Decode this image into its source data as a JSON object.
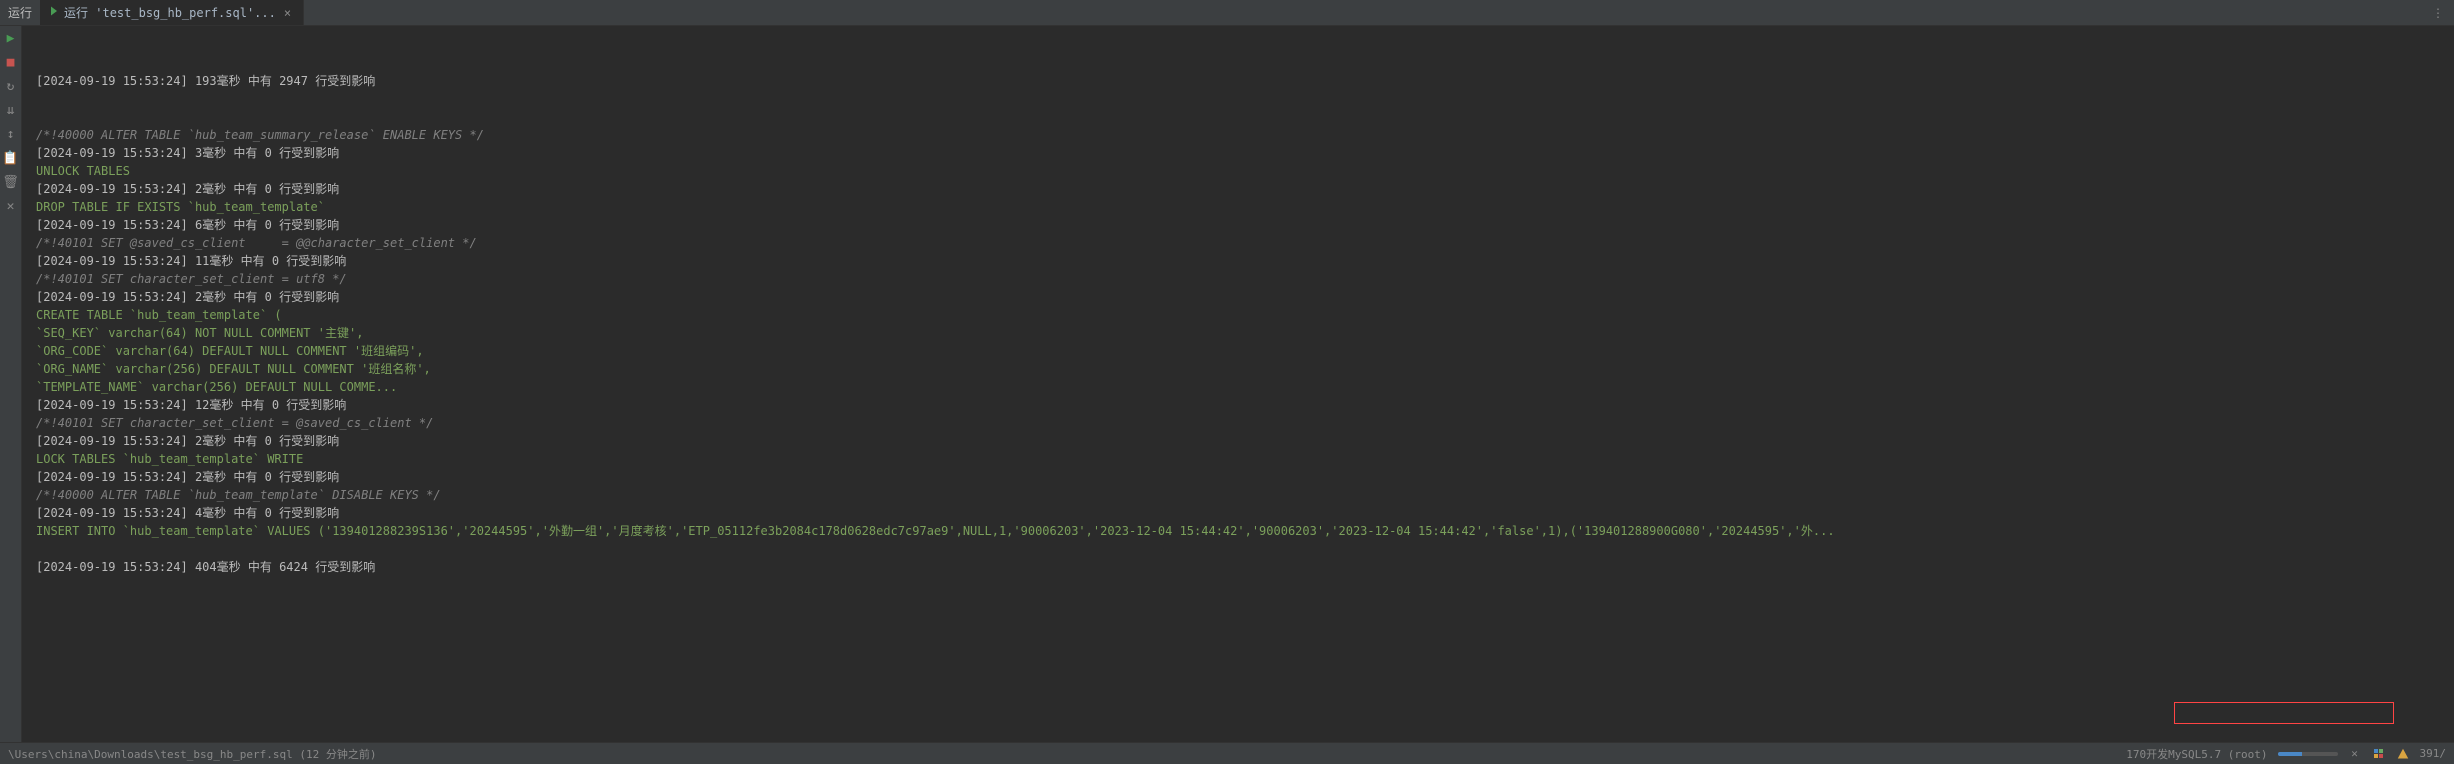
{
  "topbar": {
    "run_label": "运行",
    "tab_title": "运行 'test_bsg_hb_perf.sql'...",
    "close_symbol": "×",
    "menu_symbol": "⋮"
  },
  "toolbar": {
    "icon1": "▶",
    "icon2": "■",
    "icon3": "↻",
    "icon4": "⇊",
    "icon5": "↕",
    "icon6": "📋",
    "icon7": "🗑",
    "icon8": "✕"
  },
  "console": {
    "lines": [
      {
        "cls": "log-line",
        "text": "[2024-09-19 15:53:24] 193毫秒 中有 2947 行受到影响"
      },
      {
        "cls": "log-line",
        "text": ""
      },
      {
        "cls": "log-line",
        "text": ""
      },
      {
        "cls": "sql-comment",
        "text": "/*!40000 ALTER TABLE `hub_team_summary_release` ENABLE KEYS */"
      },
      {
        "cls": "log-line",
        "text": "[2024-09-19 15:53:24] 3毫秒 中有 0 行受到影响"
      },
      {
        "cls": "sql-stmt",
        "text": "UNLOCK TABLES"
      },
      {
        "cls": "log-line",
        "text": "[2024-09-19 15:53:24] 2毫秒 中有 0 行受到影响"
      },
      {
        "cls": "sql-stmt",
        "text": "DROP TABLE IF EXISTS `hub_team_template`"
      },
      {
        "cls": "log-line",
        "text": "[2024-09-19 15:53:24] 6毫秒 中有 0 行受到影响"
      },
      {
        "cls": "sql-comment",
        "text": "/*!40101 SET @saved_cs_client     = @@character_set_client */"
      },
      {
        "cls": "log-line",
        "text": "[2024-09-19 15:53:24] 11毫秒 中有 0 行受到影响"
      },
      {
        "cls": "sql-comment",
        "text": "/*!40101 SET character_set_client = utf8 */"
      },
      {
        "cls": "log-line",
        "text": "[2024-09-19 15:53:24] 2毫秒 中有 0 行受到影响"
      },
      {
        "cls": "sql-stmt",
        "text": "CREATE TABLE `hub_team_template` ("
      },
      {
        "cls": "sql-stmt",
        "text": "`SEQ_KEY` varchar(64) NOT NULL COMMENT '主键',"
      },
      {
        "cls": "sql-stmt",
        "text": "`ORG_CODE` varchar(64) DEFAULT NULL COMMENT '班组编码',"
      },
      {
        "cls": "sql-stmt",
        "text": "`ORG_NAME` varchar(256) DEFAULT NULL COMMENT '班组名称',"
      },
      {
        "cls": "sql-stmt",
        "text": "`TEMPLATE_NAME` varchar(256) DEFAULT NULL COMME..."
      },
      {
        "cls": "log-line",
        "text": "[2024-09-19 15:53:24] 12毫秒 中有 0 行受到影响"
      },
      {
        "cls": "sql-comment",
        "text": "/*!40101 SET character_set_client = @saved_cs_client */"
      },
      {
        "cls": "log-line",
        "text": "[2024-09-19 15:53:24] 2毫秒 中有 0 行受到影响"
      },
      {
        "cls": "sql-stmt",
        "text": "LOCK TABLES `hub_team_template` WRITE"
      },
      {
        "cls": "log-line",
        "text": "[2024-09-19 15:53:24] 2毫秒 中有 0 行受到影响"
      },
      {
        "cls": "sql-comment",
        "text": "/*!40000 ALTER TABLE `hub_team_template` DISABLE KEYS */"
      },
      {
        "cls": "log-line",
        "text": "[2024-09-19 15:53:24] 4毫秒 中有 0 行受到影响"
      },
      {
        "cls": "sql-stmt",
        "text": "INSERT INTO `hub_team_template` VALUES ('139401288239S136','20244595','外勤一组','月度考核','ETP_05112fe3b2084c178d0628edc7c97ae9',NULL,1,'90006203','2023-12-04 15:44:42','90006203','2023-12-04 15:44:42','false',1),('139401288900G080','20244595','外..."
      },
      {
        "cls": "log-line",
        "text": ""
      },
      {
        "cls": "log-line",
        "text": "[2024-09-19 15:53:24] 404毫秒 中有 6424 行受到影响"
      }
    ]
  },
  "statusbar": {
    "path": "\\Users\\china\\Downloads\\test_bsg_hb_perf.sql (12 分钟之前)",
    "connection": "170开发MySQL5.7 (root)",
    "count": "391/"
  }
}
